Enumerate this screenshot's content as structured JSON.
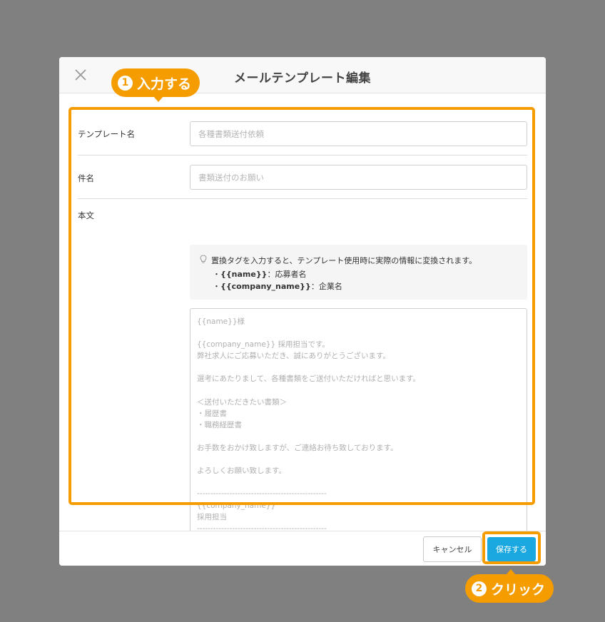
{
  "modal": {
    "title": "メールテンプレート編集"
  },
  "form": {
    "template_name_label": "テンプレート名",
    "template_name_placeholder": "各種書類送付依頼",
    "subject_label": "件名",
    "subject_placeholder": "書類送付のお願い",
    "body_label": "本文",
    "hint": {
      "text": "置換タグを入力すると、テンプレート使用時に実際の情報に変換されます。",
      "items": [
        {
          "tag": "{{name}}",
          "desc": "：応募者名"
        },
        {
          "tag": "{{company_name}}",
          "desc": "：企業名"
        }
      ]
    },
    "body_placeholder": "{{name}}様\n\n{{company_name}} 採用担当です。\n弊社求人にご応募いただき、誠にありがとうございます。\n\n選考にあたりまして、各種書類をご送付いただければと思います。\n\n＜送付いただきたい書類＞\n・履歴書\n・職務経歴書\n\nお手数をおかけ致しますが、ご連絡お待ち致しております。\n\nよろしくお願い致します。\n\n------------------------------------------------\n{{company_name}}\n採用担当\n------------------------------------------------"
  },
  "footer": {
    "cancel_label": "キャンセル",
    "save_label": "保存する"
  },
  "annotations": {
    "step1": {
      "num": "1",
      "label": "入力する"
    },
    "step2": {
      "num": "2",
      "label": "クリック"
    }
  },
  "colors": {
    "overlay": "#808080",
    "accent_orange": "#f59c00",
    "primary_blue": "#1ba8e0"
  }
}
